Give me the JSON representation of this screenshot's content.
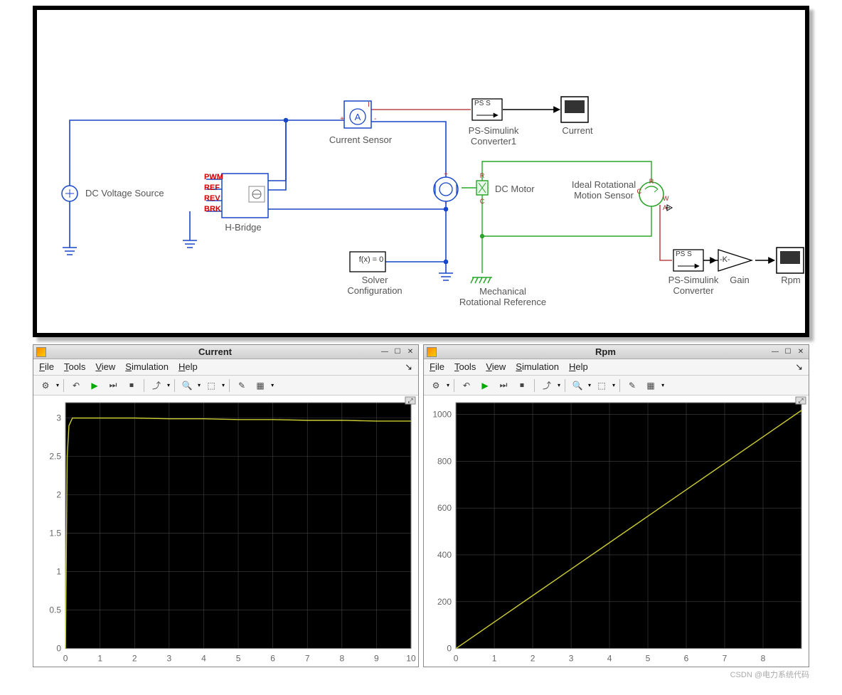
{
  "diagram": {
    "blocks": {
      "dc_voltage_source": "DC Voltage Source",
      "h_bridge": "H-Bridge",
      "h_bridge_ports": {
        "pwm": "PWM",
        "ref": "REF",
        "rev": "REV",
        "brk": "BRK"
      },
      "current_sensor": "Current Sensor",
      "solver_config": "Solver\nConfiguration",
      "solver_text": "f(x) = 0",
      "ps_simulink_converter1": "PS-Simulink\nConverter1",
      "ps_conv_text": "PS S",
      "current_scope": "Current",
      "dc_motor": "DC Motor",
      "ideal_rot_sensor": "Ideal Rotational\nMotion Sensor",
      "mech_rot_ref": "Mechanical\nRotational Reference",
      "ps_simulink_converter": "PS-Simulink\nConverter",
      "gain": "Gain",
      "gain_text": "-K-",
      "rpm_scope": "Rpm",
      "rot_ports": {
        "c": "C",
        "r": "R",
        "w": "W",
        "a": "A"
      }
    }
  },
  "scopes": {
    "current": {
      "title": "Current",
      "menus": [
        "File",
        "Tools",
        "View",
        "Simulation",
        "Help"
      ]
    },
    "rpm": {
      "title": "Rpm",
      "menus": [
        "File",
        "Tools",
        "View",
        "Simulation",
        "Help"
      ]
    }
  },
  "win_buttons": {
    "min": "—",
    "max": "☐",
    "close": "✕"
  },
  "toolbar_icons": [
    "⚙",
    "↶",
    "▶",
    "⏭",
    "⏹",
    "⤴",
    "🔍",
    "⬚",
    "✎",
    "▦"
  ],
  "chart_data": [
    {
      "type": "line",
      "title": "Current",
      "xlabel": "",
      "ylabel": "",
      "xlim": [
        0,
        10
      ],
      "ylim": [
        0,
        3.2
      ],
      "xticks": [
        0,
        1,
        2,
        3,
        4,
        5,
        6,
        7,
        8,
        9,
        10
      ],
      "yticks": [
        0,
        0.5,
        1,
        1.5,
        2,
        2.5,
        3
      ],
      "series": [
        {
          "name": "Current",
          "x": [
            0,
            0.05,
            0.1,
            0.2,
            0.5,
            1,
            2,
            3,
            4,
            5,
            6,
            7,
            8,
            9,
            10
          ],
          "y": [
            0,
            2.5,
            2.9,
            3.0,
            3.0,
            3.0,
            3.0,
            2.99,
            2.99,
            2.98,
            2.98,
            2.97,
            2.97,
            2.96,
            2.96
          ],
          "color": "#cccc33"
        }
      ]
    },
    {
      "type": "line",
      "title": "Rpm",
      "xlabel": "",
      "ylabel": "",
      "xlim": [
        0,
        9
      ],
      "ylim": [
        0,
        1050
      ],
      "xticks": [
        0,
        1,
        2,
        3,
        4,
        5,
        6,
        7,
        8
      ],
      "yticks": [
        0,
        200,
        400,
        600,
        800,
        1000
      ],
      "series": [
        {
          "name": "Rpm",
          "x": [
            0,
            1,
            2,
            3,
            4,
            5,
            6,
            7,
            8,
            9
          ],
          "y": [
            0,
            113,
            226,
            339,
            452,
            565,
            678,
            791,
            904,
            1017
          ],
          "color": "#cccc33"
        }
      ]
    }
  ],
  "footer": "CSDN @电力系统代码"
}
